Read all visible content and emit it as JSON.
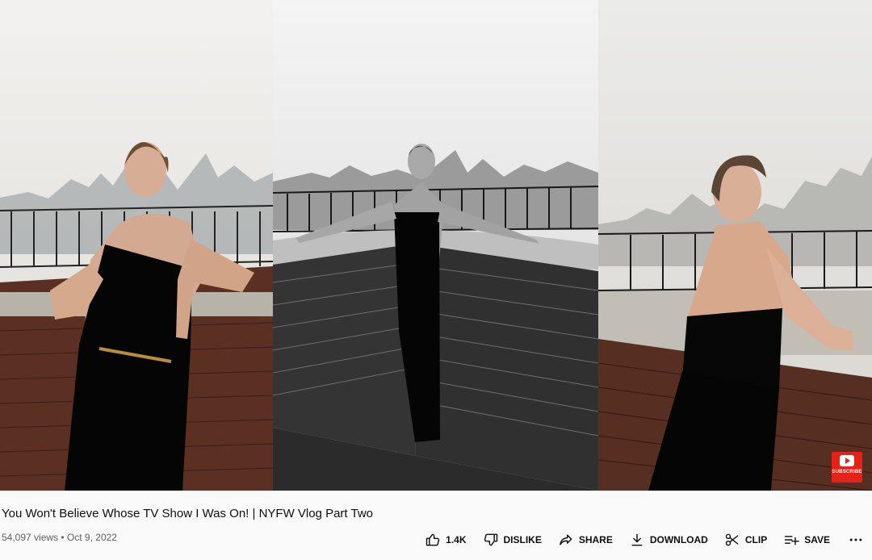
{
  "video": {
    "subscribe_badge_label": "SUBSCRIBE"
  },
  "title": "You Won't Believe Whose TV Show I Was On! | NYFW Vlog Part Two",
  "metadata": {
    "views": "54,097 views",
    "separator": " • ",
    "date": "Oct 9, 2022"
  },
  "actions": {
    "like_count": "1.4K",
    "dislike_label": "DISLIKE",
    "share_label": "SHARE",
    "download_label": "DOWNLOAD",
    "clip_label": "CLIP",
    "save_label": "SAVE"
  },
  "icons": {
    "thumbs_up": "thumbs-up-icon",
    "thumbs_down": "thumbs-down-icon",
    "share": "share-icon",
    "download": "download-icon",
    "clip": "scissors-icon",
    "save": "add-to-playlist-icon",
    "more": "more-horizontal-icon",
    "subscribe": "youtube-play-icon"
  },
  "colors": {
    "background": "#f9f9f9",
    "title_text": "#0f0f0f",
    "meta_text": "#606060",
    "subscribe_red": "#e62117"
  }
}
